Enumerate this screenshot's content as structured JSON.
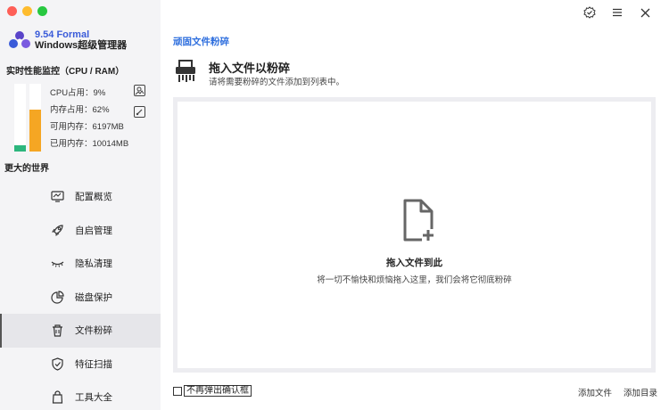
{
  "app": {
    "version": "9.54 Formal",
    "name": "Windows超级管理器"
  },
  "performance": {
    "title": "实时性能监控（CPU / RAM）",
    "cpu_label": "CPU占用：9%",
    "ram_label": "内存占用：62%",
    "available_label": "可用内存：6197MB",
    "used_label": "已用内存：10014MB",
    "cpu_percent": 9,
    "ram_percent": 62,
    "cpu_color": "#2cb67d",
    "ram_color": "#f5a623"
  },
  "sidebar": {
    "world_label": "更大的世界",
    "items": [
      {
        "label": "配置概览",
        "icon": "monitor-icon"
      },
      {
        "label": "自启管理",
        "icon": "rocket-icon"
      },
      {
        "label": "隐私清理",
        "icon": "closed-eye-icon"
      },
      {
        "label": "磁盘保护",
        "icon": "pie-chart-icon"
      },
      {
        "label": "文件粉碎",
        "icon": "trash-icon"
      },
      {
        "label": "特征扫描",
        "icon": "shield-icon"
      },
      {
        "label": "工具大全",
        "icon": "bag-icon"
      }
    ],
    "active_index": 4
  },
  "main": {
    "breadcrumb": "顽固文件粉碎",
    "title": "拖入文件以粉碎",
    "subtitle": "请将需要粉碎的文件添加到列表中。",
    "drop_title": "拖入文件到此",
    "drop_subtitle": "将一切不愉快和烦恼拖入这里，我们会将它彻底粉碎"
  },
  "footer": {
    "no_confirm_label": "不再弹出确认框",
    "add_file": "添加文件",
    "add_dir": "添加目录"
  },
  "colors": {
    "accent": "#2f6fde",
    "brand": "#3a5bd9"
  }
}
